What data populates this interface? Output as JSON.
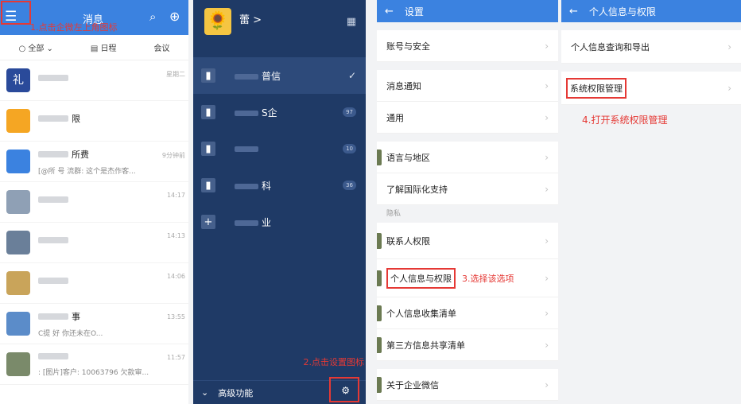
{
  "panel1": {
    "header": {
      "title": "消息",
      "hint": "1.点击企微左上角图标"
    },
    "filters": [
      "○ 全部 ⌄",
      "▤ 日程",
      "会议"
    ],
    "rows": [
      {
        "name": "",
        "sub": "",
        "time": "星期二",
        "color": "#2a4a9a",
        "glyph": "礼"
      },
      {
        "name": "限",
        "sub": "",
        "time": "",
        "color": "#f5a623",
        "glyph": ""
      },
      {
        "name": "所费",
        "sub": "[@所  号  流群: 这个是杰作客...",
        "time": "9分钟前",
        "color": "#3b82e0",
        "glyph": ""
      },
      {
        "name": "",
        "sub": "",
        "time": "14:17",
        "color": "#8fa0b5",
        "glyph": ""
      },
      {
        "name": "",
        "sub": "",
        "time": "14:13",
        "color": "#6a7f99",
        "glyph": ""
      },
      {
        "name": "",
        "sub": "",
        "time": "14:06",
        "color": "#c9a45a",
        "glyph": ""
      },
      {
        "name": "事",
        "sub": "C提  好  你还未在O...",
        "time": "13:55",
        "color": "#5b8cc9",
        "glyph": ""
      },
      {
        "name": "",
        "sub": ": [图片]客户: 10063796 欠款审...",
        "time": "11:57",
        "color": "#7a8a6a",
        "glyph": ""
      }
    ]
  },
  "panel2": {
    "user_name": "蕾 >",
    "items": [
      {
        "label": "普信",
        "badge": "",
        "check": "✓",
        "active": true
      },
      {
        "label": "S企",
        "badge": "97",
        "check": "",
        "active": false
      },
      {
        "label": "",
        "badge": "10",
        "check": "",
        "active": false
      },
      {
        "label": "科",
        "badge": "36",
        "check": "",
        "active": false
      },
      {
        "label": "业",
        "badge": "",
        "check": "",
        "active": false
      }
    ],
    "footer_label": "高级功能",
    "hint": "2.点击设置图标"
  },
  "panel3": {
    "title": "设置",
    "section_privacy": "隐私",
    "items": {
      "account": "账号与安全",
      "notify": "消息通知",
      "general": "通用",
      "language": "语言与地区",
      "intl": "了解国际化支持",
      "contact_perm": "联系人权限",
      "personal_info": "个人信息与权限",
      "collect_list": "个人信息收集清单",
      "share_list": "第三方信息共享清单",
      "about": "关于企业微信"
    },
    "hint": "3.选择该选项"
  },
  "panel4": {
    "title": "个人信息与权限",
    "items": {
      "export": "个人信息查询和导出",
      "sys_perm": "系统权限管理"
    },
    "hint": "4.打开系统权限管理"
  }
}
